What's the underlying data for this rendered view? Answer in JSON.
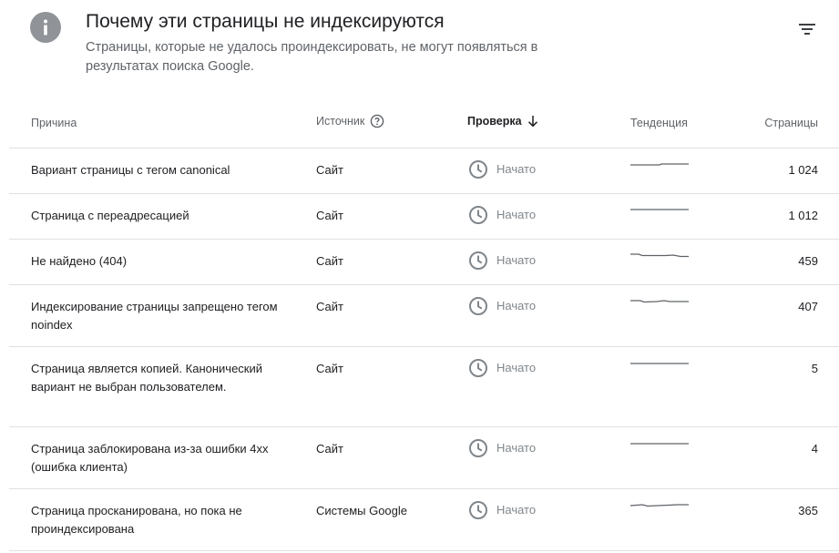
{
  "header": {
    "title": "Почему эти страницы не индексируются",
    "subtitle": "Страницы, которые не удалось проиндексировать, не могут появляться в результатах поиска Google."
  },
  "table": {
    "columns": {
      "reason": "Причина",
      "source": "Источник",
      "check": "Проверка",
      "trend": "Тенденция",
      "pages": "Страницы"
    },
    "rows": [
      {
        "reason": "Вариант страницы с тегом canonical",
        "source": "Сайт",
        "status": "Начато",
        "pages": "1 024"
      },
      {
        "reason": "Страница с переадресацией",
        "source": "Сайт",
        "status": "Начато",
        "pages": "1 012"
      },
      {
        "reason": "Не найдено (404)",
        "source": "Сайт",
        "status": "Начато",
        "pages": "459"
      },
      {
        "reason": "Индексирование страницы запрещено тегом noindex",
        "source": "Сайт",
        "status": "Начато",
        "pages": "407"
      },
      {
        "reason": "Страница является копией. Канонический вариант не выбран пользователем.",
        "source": "Сайт",
        "status": "Начато",
        "pages": "5"
      },
      {
        "reason": "Страница заблокирована из-за ошибки 4xx (ошибка клиента)",
        "source": "Сайт",
        "status": "Начато",
        "pages": "4"
      },
      {
        "reason": "Страница просканирована, но пока не проиндексирована",
        "source": "Системы Google",
        "status": "Начато",
        "pages": "365"
      }
    ]
  },
  "icons": {
    "info": "info-icon",
    "filter": "filter-icon",
    "help": "help-icon",
    "sort": "arrow-down-icon",
    "status": "clock-icon"
  },
  "colors": {
    "info_bg": "#909398",
    "status_text": "#80868b",
    "trend_line": "#5f6368",
    "divider": "#e0e0e0"
  }
}
